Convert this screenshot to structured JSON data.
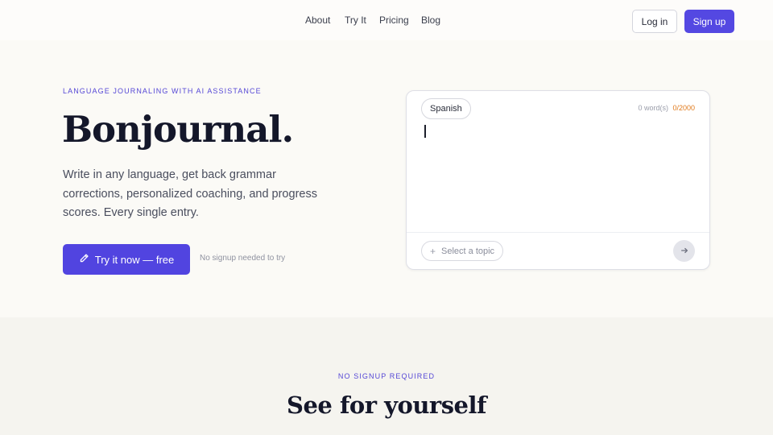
{
  "nav": {
    "links": [
      "About",
      "Try It",
      "Pricing",
      "Blog"
    ],
    "login_label": "Log in",
    "signup_label": "Sign up"
  },
  "hero": {
    "eyebrow": "LANGUAGE JOURNALING WITH AI ASSISTANCE",
    "brand": "Bonjournal.",
    "description": "Write in any language, get back grammar corrections, personalized coaching, and progress scores. Every single entry.",
    "cta_label": "Try it now — free",
    "cta_icon": "pencil-icon",
    "cta_note": "No signup needed to try"
  },
  "editor": {
    "language": "Spanish",
    "word_count": "0 word(s)",
    "char_limit": "0/2000",
    "text": "",
    "topic_placeholder": "Select a topic",
    "send_icon": "arrow-right-icon"
  },
  "lower": {
    "eyebrow": "NO SIGNUP REQUIRED",
    "title": "See for yourself"
  },
  "colors": {
    "accent": "#5144e0",
    "limit_orange": "#e07a1c",
    "page_bg": "#fbfaf6",
    "section_bg": "#f5f4ef"
  }
}
